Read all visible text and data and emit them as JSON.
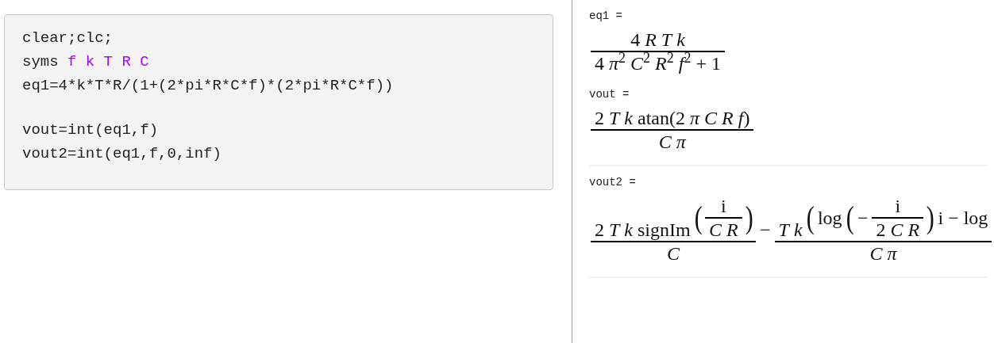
{
  "code_groups": [
    {
      "lines": [
        [
          {
            "kind": "plain",
            "text": "clear;clc;"
          }
        ],
        [
          {
            "kind": "plain",
            "text": "syms "
          },
          {
            "kind": "symbol",
            "text": "f k T R C"
          }
        ],
        [
          {
            "kind": "plain",
            "text": "eq1=4*k*T*R/(1+(2*pi*R*C*f)*(2*pi*R*C*f))"
          }
        ]
      ]
    },
    {
      "lines": [
        [
          {
            "kind": "plain",
            "text": "vout=int(eq1,f)"
          }
        ],
        [
          {
            "kind": "plain",
            "text": "vout2=int(eq1,f,0,inf)"
          }
        ]
      ]
    }
  ],
  "output_groups": [
    {
      "outputs": [
        {
          "label": "eq1 =",
          "expr": [
            {
              "kind": "frac",
              "num": [
                {
                  "kind": "text",
                  "text": "4 *R* *T* *k*"
                }
              ],
              "den": [
                {
                  "kind": "text",
                  "text": "4 *π*$^{2}$ *C*$^{2}$ *R*$^{2}$ *f*$^{2}$ + 1"
                }
              ]
            }
          ]
        },
        {
          "label": "vout =",
          "expr": [
            {
              "kind": "frac",
              "num": [
                {
                  "kind": "text",
                  "text": "2 *T* *k* atan(2 *π* *C* *R* *f*)"
                }
              ],
              "den": [
                {
                  "kind": "text",
                  "text": "*C* *π*"
                }
              ]
            }
          ]
        }
      ]
    },
    {
      "outputs": [
        {
          "label": "vout2 =",
          "expr": [
            {
              "kind": "frac",
              "num": [
                {
                  "kind": "text",
                  "text": "2 *T* *k* signIm"
                },
                {
                  "kind": "paren",
                  "open": "(",
                  "close": ")",
                  "body": [
                    {
                      "kind": "frac",
                      "num": [
                        {
                          "kind": "text",
                          "text": "i"
                        }
                      ],
                      "den": [
                        {
                          "kind": "text",
                          "text": "*C* *R*"
                        }
                      ]
                    }
                  ]
                }
              ],
              "den": [
                {
                  "kind": "text",
                  "text": "*C*"
                }
              ]
            },
            {
              "kind": "text",
              "text": "−"
            },
            {
              "kind": "frac",
              "num": [
                {
                  "kind": "text",
                  "text": "*T* *k*"
                },
                {
                  "kind": "paren",
                  "open": "(",
                  "body": [
                    {
                      "kind": "text",
                      "text": "log"
                    },
                    {
                      "kind": "paren",
                      "open": "(",
                      "close": ")",
                      "body": [
                        {
                          "kind": "text",
                          "text": "−"
                        },
                        {
                          "kind": "frac",
                          "num": [
                            {
                              "kind": "text",
                              "text": "i"
                            }
                          ],
                          "den": [
                            {
                              "kind": "text",
                              "text": "2 *C* *R*"
                            }
                          ]
                        }
                      ]
                    },
                    {
                      "kind": "text",
                      "text": "i − log"
                    }
                  ]
                }
              ],
              "den": [
                {
                  "kind": "text",
                  "text": "*C* *π*"
                }
              ]
            }
          ]
        }
      ]
    }
  ]
}
